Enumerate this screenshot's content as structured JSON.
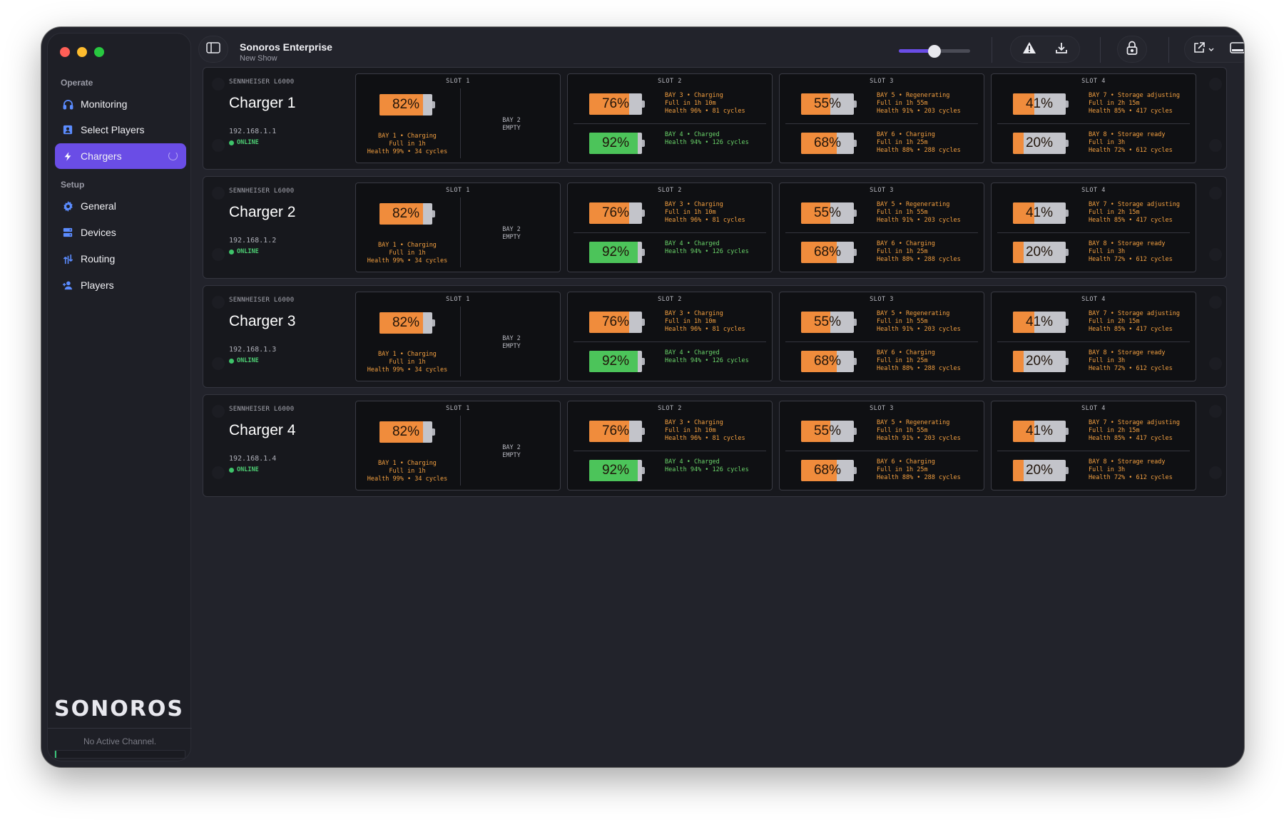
{
  "window": {
    "title": "Sonoros Enterprise",
    "subtitle": "New Show",
    "volume_level": 0.5
  },
  "sidebar": {
    "sections": [
      {
        "label": "Operate",
        "items": [
          {
            "label": "Monitoring",
            "icon": "headphones-icon"
          },
          {
            "label": "Select Players",
            "icon": "contact-card-icon"
          },
          {
            "label": "Chargers",
            "icon": "bolt-icon",
            "active": true
          }
        ]
      },
      {
        "label": "Setup",
        "items": [
          {
            "label": "General",
            "icon": "gear-icon"
          },
          {
            "label": "Devices",
            "icon": "server-icon"
          },
          {
            "label": "Routing",
            "icon": "routing-icon"
          },
          {
            "label": "Players",
            "icon": "add-person-icon"
          }
        ]
      }
    ],
    "brand": "SONOROS",
    "channel_status": "No Active Channel."
  },
  "colors": {
    "accent": "#6a4de6",
    "battery_orange": "#f08c3c",
    "battery_green": "#4cc45a",
    "online_green": "#3ec46a"
  },
  "chargers": [
    {
      "model": "SENNHEISER L6000",
      "name": "Charger 1",
      "ip": "192.168.1.1",
      "status": "ONLINE"
    },
    {
      "model": "SENNHEISER L6000",
      "name": "Charger 2",
      "ip": "192.168.1.2",
      "status": "ONLINE"
    },
    {
      "model": "SENNHEISER L6000",
      "name": "Charger 3",
      "ip": "192.168.1.3",
      "status": "ONLINE"
    },
    {
      "model": "SENNHEISER L6000",
      "name": "Charger 4",
      "ip": "192.168.1.4",
      "status": "ONLINE"
    }
  ],
  "slots": {
    "slot1": {
      "title": "SLOT 1",
      "bay1": {
        "percent": "82%",
        "level": 0.82,
        "color": "orange",
        "line1": "BAY 1 • Charging",
        "line2": "Full in 1h",
        "line3": "Health 99% • 34 cycles"
      },
      "bay2_line1": "BAY 2",
      "bay2_line2": "EMPTY"
    },
    "slot2": {
      "title": "SLOT 2",
      "top": {
        "percent": "76%",
        "level": 0.76,
        "color": "orange",
        "line1": "BAY 3 • Charging",
        "line2": "Full in 1h 10m",
        "line3": "Health 96% • 81 cycles"
      },
      "bottom": {
        "percent": "92%",
        "level": 0.92,
        "color": "green",
        "line1": "BAY 4 • Charged",
        "line2": "Health 94% • 126 cycles",
        "line3": ""
      }
    },
    "slot3": {
      "title": "SLOT 3",
      "top": {
        "percent": "55%",
        "level": 0.55,
        "color": "orange",
        "line1": "BAY 5 • Regenerating",
        "line2": "Full in 1h 55m",
        "line3": "Health 91% • 203 cycles"
      },
      "bottom": {
        "percent": "68%",
        "level": 0.68,
        "color": "orange",
        "line1": "BAY 6 • Charging",
        "line2": "Full in 1h 25m",
        "line3": "Health 88% • 288 cycles"
      }
    },
    "slot4": {
      "title": "SLOT 4",
      "top": {
        "percent": "41%",
        "level": 0.41,
        "color": "orange",
        "line1": "BAY 7 • Storage adjusting",
        "line2": "Full in 2h 15m",
        "line3": "Health 85% • 417 cycles"
      },
      "bottom": {
        "percent": "20%",
        "level": 0.2,
        "color": "orange",
        "line1": "BAY 8 • Storage ready",
        "line2": "Full in 3h",
        "line3": "Health 72% • 612 cycles"
      }
    }
  }
}
